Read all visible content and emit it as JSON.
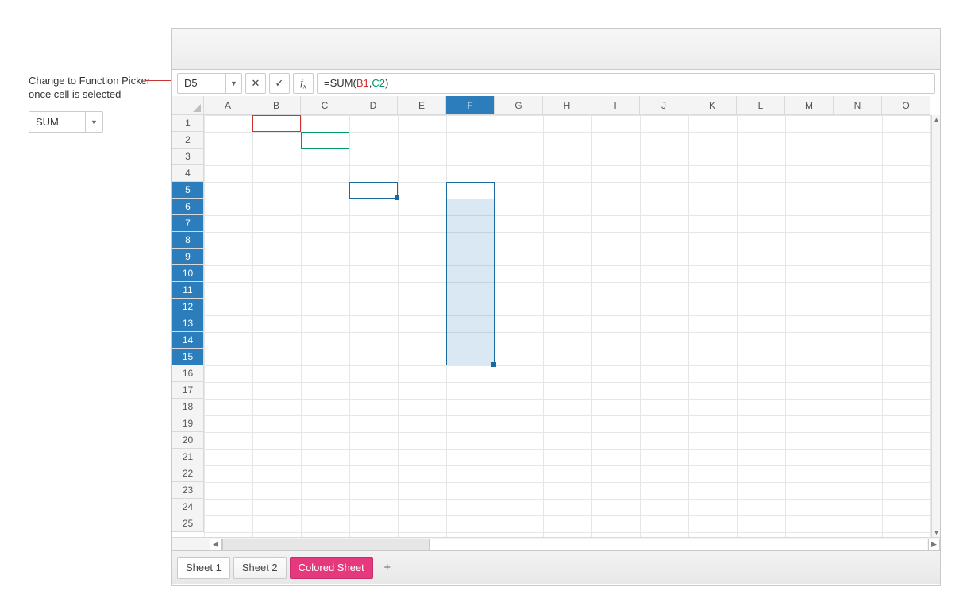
{
  "callout": "Change to Function Picker once cell is selected",
  "function_picker": {
    "value": "SUM"
  },
  "name_box": "D5",
  "formula": {
    "prefix": "=SUM(",
    "ref1": "B1",
    "comma": ",",
    "ref2": "C2",
    "suffix": ")"
  },
  "columns": [
    "A",
    "B",
    "C",
    "D",
    "E",
    "F",
    "G",
    "H",
    "I",
    "J",
    "K",
    "L",
    "M",
    "N",
    "O"
  ],
  "col_widths": {
    "default": 61,
    "A": 61
  },
  "rows": [
    1,
    2,
    3,
    4,
    5,
    6,
    7,
    8,
    9,
    10,
    11,
    12,
    13,
    14,
    15,
    16,
    17,
    18,
    19,
    20,
    21,
    22,
    23,
    24,
    25
  ],
  "selected_col": "F",
  "selected_rows_start": 5,
  "selected_rows_end": 15,
  "active_cell": "D5",
  "refs": {
    "red": "B1",
    "green": "C2"
  },
  "tabs": [
    {
      "label": "Sheet 1",
      "active": true
    },
    {
      "label": "Sheet 2"
    },
    {
      "label": "Colored Sheet",
      "colored": true
    }
  ],
  "icons": {
    "cancel": "✕",
    "accept": "✓",
    "dropdown": "▼",
    "left": "◀",
    "right": "▶",
    "up": "▲",
    "down": "▼",
    "plus": "+"
  }
}
